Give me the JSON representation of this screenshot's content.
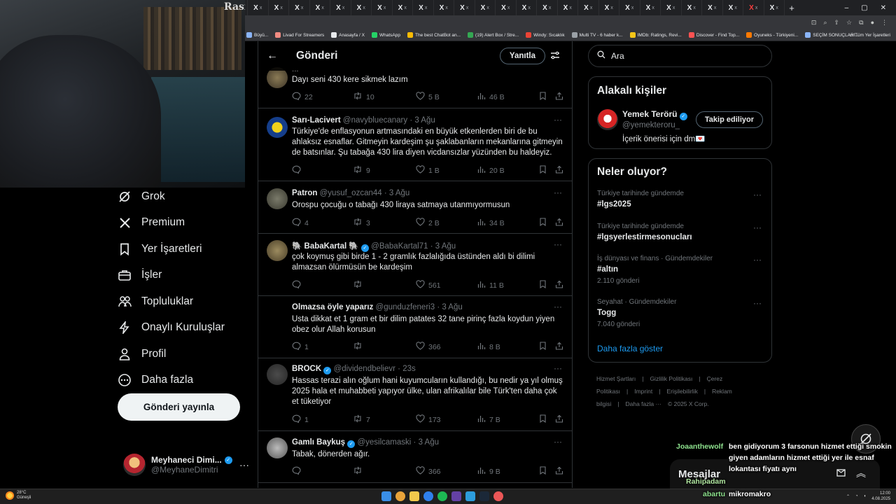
{
  "browser": {
    "tab_glyph": "X",
    "tab_close": "x",
    "new_tab": "+",
    "bookmarks": [
      {
        "label": "Büyü..."
      },
      {
        "label": "Livad For Streamers"
      },
      {
        "label": "Anasayfa / X"
      },
      {
        "label": "WhatsApp"
      },
      {
        "label": "The best ChatBot an..."
      },
      {
        "label": "(19) Alert Box / Stre..."
      },
      {
        "label": "Windy: Sıcaklık"
      },
      {
        "label": "Multi TV - 6 haber k..."
      },
      {
        "label": "IMDb: Ratings, Revi..."
      },
      {
        "label": "Discover - Find Top..."
      },
      {
        "label": "Oyuneks - Türkiyeni..."
      },
      {
        "label": "SEÇİM SONUÇLARI..."
      }
    ],
    "all_bookmarks": "Tüm Yer İşaretleri"
  },
  "nav": {
    "items": [
      {
        "label": "Grok",
        "icon": "grok-icon"
      },
      {
        "label": "Premium",
        "icon": "x-logo-icon"
      },
      {
        "label": "Yer İşaretleri",
        "icon": "bookmark-icon"
      },
      {
        "label": "İşler",
        "icon": "briefcase-icon"
      },
      {
        "label": "Topluluklar",
        "icon": "people-icon"
      },
      {
        "label": "Onaylı Kuruluşlar",
        "icon": "lightning-icon"
      },
      {
        "label": "Profil",
        "icon": "person-icon"
      },
      {
        "label": "Daha fazla",
        "icon": "more-circle-icon"
      }
    ],
    "post_button": "Gönderi yayınla",
    "profile": {
      "name": "Meyhaneci Dimi...",
      "handle": "@MeyhaneDimitri",
      "more": "···"
    }
  },
  "main": {
    "title": "Gönderi",
    "reply_button": "Yanıtla",
    "tweets": [
      {
        "name": "...",
        "handle": "",
        "time": "",
        "text": "Dayı seni 430 kere sikmek lazım",
        "replies": "22",
        "retweets": "10",
        "likes": "5 B",
        "views": "46 B"
      },
      {
        "name": "Sarı-Lacivert",
        "handle": "@navybluecanary",
        "time": "· 3 Ağu",
        "text": "Türkiye'de enflasyonun artmasındaki en büyük etkenlerden biri de bu ahlaksız esnaflar. Gitmeyin kardeşim şu şaklabanların mekanlarına gitmeyin de batsınlar. Şu tabağa 430 lira diyen vicdansızlar yüzünden bu haldeyiz.",
        "replies": "",
        "retweets": "9",
        "likes": "1 B",
        "views": "20 B"
      },
      {
        "name": "Patron",
        "handle": "@yusuf_ozcan44",
        "time": "· 3 Ağu",
        "text": "Orospu çocuğu o tabağı 430 liraya satmaya utanmıyormusun",
        "replies": "4",
        "retweets": "3",
        "likes": "2 B",
        "views": "34 B"
      },
      {
        "name": "🐘 BabaKartal 🐘",
        "handle": "@BabaKartal71",
        "time": "· 3 Ağu",
        "text": "çok koymuş gibi birde 1 - 2 gramlık fazlalığıda üstünden aldı bi dilimi almazsan ölürmüsün be kardeşim",
        "replies": "",
        "retweets": "",
        "likes": "561",
        "views": "11 B"
      },
      {
        "name": "Olmazsa öyle yaparız",
        "handle": "@gunduzfeneri3",
        "time": "· 3 Ağu",
        "text": "Usta dikkat et 1 gram et  bir dilim patates 32 tane pirinç fazla koydun yiyen obez olur Allah korusun",
        "replies": "1",
        "retweets": "",
        "likes": "366",
        "views": "8 B"
      },
      {
        "name": "BROCK",
        "handle": "@dividendbelievr",
        "time": "· 23s",
        "text": "Hassas terazi alın oğlum hani kuyumcuların kullandığı, bu nedir ya yıl olmuş 2025 hala et muhabbeti yapıyor ülke, ulan afrikalılar bile Türk'ten daha çok et tüketiyor",
        "replies": "1",
        "retweets": "7",
        "likes": "173",
        "views": "7 B"
      },
      {
        "name": "Gamlı Baykuş",
        "handle": "@yesilcamaski",
        "time": "· 3 Ağu",
        "text": "Tabak, dönerden ağır.",
        "replies": "",
        "retweets": "",
        "likes": "366",
        "views": "9 B"
      }
    ]
  },
  "right": {
    "search_placeholder": "Ara",
    "related_title": "Alakalı kişiler",
    "related": {
      "name": "Yemek Terörü",
      "handle": "@yemekteroru_",
      "bio": "İçerik önerisi için dm💌",
      "follow": "Takip ediliyor"
    },
    "trends_title": "Neler oluyor?",
    "trends": [
      {
        "context": "Türkiye tarihinde gündemde",
        "name": "#lgs2025",
        "count": ""
      },
      {
        "context": "Türkiye tarihinde gündemde",
        "name": "#lgsyerlestirmesonucları",
        "count": ""
      },
      {
        "context": "İş dünyası ve finans · Gündemdekiler",
        "name": "#altın",
        "count": "2.110 gönderi"
      },
      {
        "context": "Seyahat · Gündemdekiler",
        "name": "Togg",
        "count": "7.040 gönderi"
      }
    ],
    "show_more": "Daha fazla göster",
    "footer": [
      "Hizmet Şartları",
      "|",
      "Gizlilik Politikası",
      "|",
      "Çerez Politikası",
      "|",
      "Imprint",
      "|",
      "Erişilebilirlik",
      "|",
      "Reklam bilgisi",
      "|",
      "Daha fazla ···",
      "© 2025 X Corp."
    ]
  },
  "chat": {
    "lines": [
      {
        "user": "Joaanthewolf",
        "msg": "ben gidiyorum 3 farsonun hizmet ettiği smokin"
      },
      {
        "user": "",
        "msg": "giyen adamların hizmet ettiği yer ile esnaf"
      },
      {
        "user": "",
        "msg": "lokantası fiyatı aynı"
      },
      {
        "user": "Rahipadam",
        "msg": ""
      },
      {
        "user": "abartu",
        "msg": "mikromakro"
      }
    ],
    "messages_title": "Mesajlar"
  },
  "taskbar": {
    "temp": "28°C",
    "weather": "Güneşli",
    "time": "12:00",
    "date": "4.08.2025"
  },
  "colors": {
    "accent": "#1d9bf0",
    "bg": "#000000",
    "muted": "#71767b",
    "border": "#2f3336"
  }
}
